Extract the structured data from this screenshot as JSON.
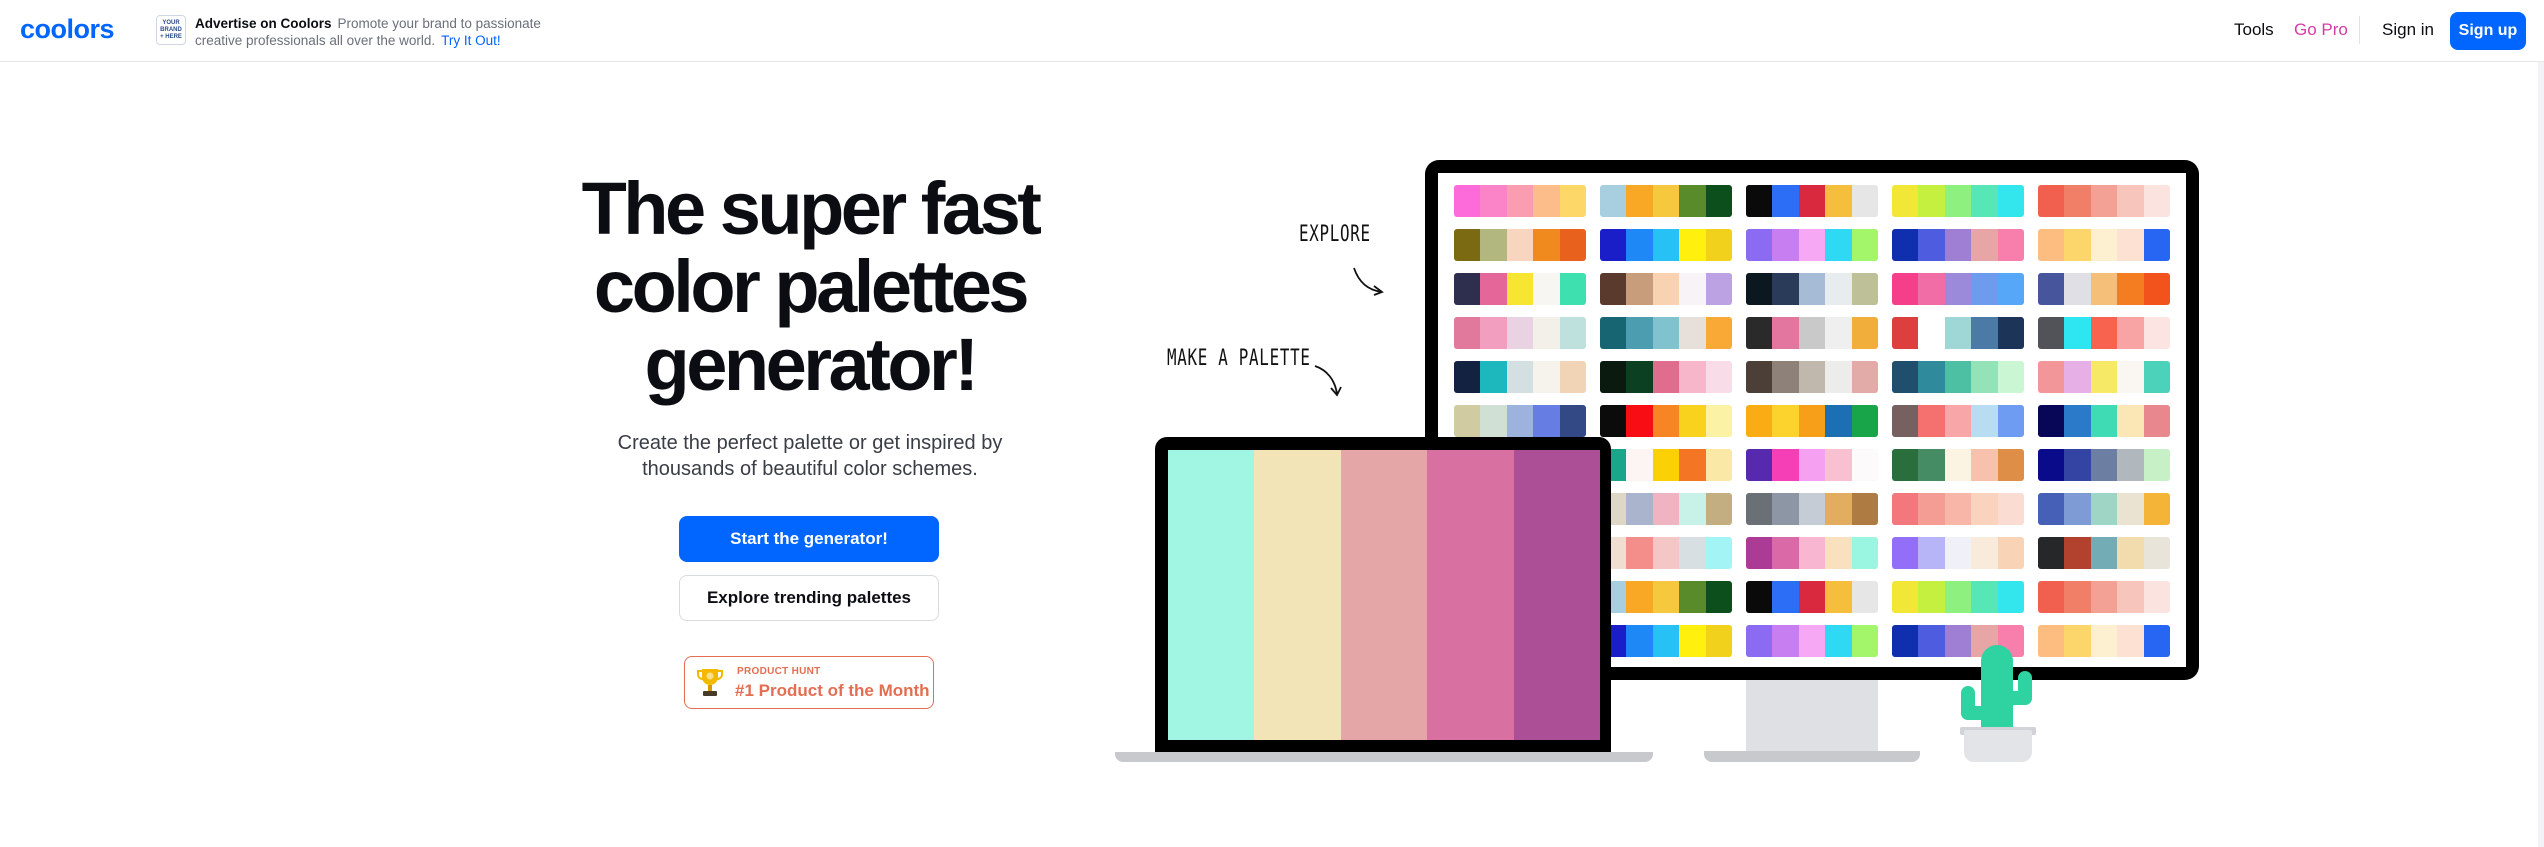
{
  "nav": {
    "logo": "coolors",
    "ad": {
      "badge_lines": [
        "YOUR",
        "BRAND",
        "+ HERE"
      ],
      "title": "Advertise on Coolors",
      "line1": "Promote your brand to passionate",
      "line2": "creative professionals all over the world.",
      "link": "Try It Out!"
    },
    "tools": "Tools",
    "go_pro": "Go Pro",
    "sign_in": "Sign in",
    "sign_up": "Sign up"
  },
  "hero": {
    "title_lines": [
      "The super fast",
      "color palettes",
      "generator!"
    ],
    "subtitle_lines": [
      "Create the perfect palette or get inspired by",
      "thousands of beautiful color schemes."
    ],
    "start_button": "Start the generator!",
    "explore_button": "Explore trending palettes",
    "product_hunt": {
      "small": "PRODUCT HUNT",
      "big": "#1 Product of the Month"
    }
  },
  "illustration": {
    "explore_label": "EXPLORE",
    "make_label": "MAKE A PALETTE",
    "laptop_palette": [
      "#a0f5e3",
      "#f3e4b8",
      "#e4a6a6",
      "#d970a2",
      "#ad4f97"
    ],
    "monitor_palettes": [
      [
        [
          "#fc6bd9",
          "#fb83c8",
          "#fb9db0",
          "#fcbd8b",
          "#fdd869"
        ],
        [
          "#a7cfe0",
          "#f9a826",
          "#f6c83d",
          "#5a8b2b",
          "#0c4e1c"
        ],
        [
          "#0a0a0a",
          "#2c6ff6",
          "#d8293e",
          "#f5be3c",
          "#e6e6e6"
        ],
        [
          "#f2e737",
          "#c5f03f",
          "#8ef07e",
          "#57e6b5",
          "#33e6ee"
        ],
        [
          "#f1604f",
          "#f17e66",
          "#f3a194",
          "#f8c5bd",
          "#fbe3df"
        ]
      ],
      [
        [
          "#7c6a13",
          "#b2b67f",
          "#f7d5bf",
          "#f18a1e",
          "#e9621d"
        ],
        [
          "#1a1ec8",
          "#1e88f6",
          "#27c1f5",
          "#fff00d",
          "#f2d11d"
        ],
        [
          "#8a6bf1",
          "#c77ef1",
          "#f6a8f4",
          "#2fd9f4",
          "#a3f56a"
        ],
        [
          "#102fae",
          "#4e5de0",
          "#9e7fd4",
          "#e7a5a5",
          "#f87fac"
        ],
        [
          "#fdbd81",
          "#fcd66a",
          "#fcf0d1",
          "#fde2d4",
          "#2766f2"
        ]
      ],
      [
        [
          "#2e2e4e",
          "#e5679a",
          "#f6e631",
          "#f7f6f2",
          "#3ee0b0"
        ],
        [
          "#5a3a2c",
          "#c89d7c",
          "#f9d2b2",
          "#f7f3f6",
          "#bca2e3"
        ],
        [
          "#0b1820",
          "#2a3b5a",
          "#a6bcd6",
          "#e7ecef",
          "#bec198"
        ],
        [
          "#f53f8a",
          "#f06da6",
          "#9a8ad9",
          "#6d9bee",
          "#56a7f8"
        ],
        [
          "#46559c",
          "#e0dfe6",
          "#f5bf7a",
          "#f47d22",
          "#f2521b"
        ]
      ],
      [
        [
          "#e0799c",
          "#f29fbf",
          "#e9d2e2",
          "#f3f0ea",
          "#bfe1de"
        ],
        [
          "#176573",
          "#4c9daf",
          "#80c3cf",
          "#e7e0da",
          "#f9a936"
        ],
        [
          "#2a2a2a",
          "#e3769f",
          "#c9c9c9",
          "#f0efef",
          "#f2ae3b"
        ],
        [
          "#dd3f3f",
          "#ffffff",
          "#9fd6d6",
          "#4a7aa5",
          "#1b3457"
        ],
        [
          "#515358",
          "#2ee6f1",
          "#f7634f",
          "#f8a4a4",
          "#fbe4e1"
        ]
      ],
      [
        [
          "#122240",
          "#1db7be",
          "#d4dfe2",
          "#f6f2ec",
          "#f1d4b6"
        ],
        [
          "#0a1a0e",
          "#0c4023",
          "#e06c8e",
          "#f8b6cb",
          "#f8dde8"
        ],
        [
          "#4b3f38",
          "#8e8179",
          "#c1b8ad",
          "#ececea",
          "#e2aba7"
        ],
        [
          "#1f4f6c",
          "#2f8a9c",
          "#4dc0a3",
          "#94e2b7",
          "#cbf6d4"
        ],
        [
          "#f2969a",
          "#e6b0e6",
          "#f5e966",
          "#faf6f1",
          "#4cd1ba"
        ]
      ],
      [
        [
          "#d1cba1",
          "#d1e0d5",
          "#9db3de",
          "#667ee3",
          "#324985"
        ],
        [
          "#0b0b0b",
          "#f70d13",
          "#f88524",
          "#f9d21e",
          "#fbf2a5"
        ],
        [
          "#f9ac13",
          "#fbd32c",
          "#f89f1a",
          "#1c6fb3",
          "#18a54a"
        ],
        [
          "#766160",
          "#f5716f",
          "#f9a6a8",
          "#b8dcf2",
          "#6e9cf3"
        ],
        [
          "#070657",
          "#2b79c9",
          "#3fdbb5",
          "#fbe6b5",
          "#e9878f"
        ]
      ],
      [
        [
          "#12a076",
          "#ffffff",
          "#f7e9d0",
          "#f16d2c",
          "#f9c9c4"
        ],
        [
          "#1aa68a",
          "#fdf5f4",
          "#fbd106",
          "#f47523",
          "#fae8a7"
        ],
        [
          "#5629ae",
          "#f53fb7",
          "#f5a0f0",
          "#f8c0d1",
          "#fcfafa"
        ],
        [
          "#2b6e3d",
          "#458c64",
          "#fbf4e2",
          "#f8c1ad",
          "#df8e47"
        ],
        [
          "#090b8a",
          "#3344a3",
          "#6c7fa3",
          "#b0b8bd",
          "#c8f0c6"
        ]
      ],
      [
        [
          "#efeeee",
          "#a89ac7",
          "#aec4dd",
          "#d2f6ec",
          "#d9cc9c"
        ],
        [
          "#ded7c5",
          "#aab5cd",
          "#f0b3c1",
          "#c8f1e7",
          "#c3ae81"
        ],
        [
          "#6b7077",
          "#8c96a5",
          "#c5ccd6",
          "#e2ad5e",
          "#ae7b43"
        ],
        [
          "#f3787d",
          "#f49d94",
          "#f8b6a9",
          "#fad3be",
          "#fbdcd2"
        ],
        [
          "#4660b7",
          "#7f9bd6",
          "#9fd5c4",
          "#eae3d2",
          "#f3b438"
        ]
      ],
      [
        [
          "#f37575",
          "#e99e9e",
          "#d6b6b6",
          "#b6d4d4",
          "#8ef4f4"
        ],
        [
          "#f0ded0",
          "#f38e8b",
          "#f5c6c6",
          "#d8dfe3",
          "#a2f5f4"
        ],
        [
          "#ab3b94",
          "#da6aa7",
          "#f8b6d0",
          "#f9e1bf",
          "#9af5e1"
        ],
        [
          "#936ef8",
          "#b7b4f8",
          "#f0f0f8",
          "#f9ebdb",
          "#f9d3b6"
        ],
        [
          "#252729",
          "#b2422e",
          "#73acb5",
          "#f2dcae",
          "#e9e4d9"
        ]
      ],
      [
        [
          "#a7cfe0",
          "#f9a826",
          "#f6c83d",
          "#5a8b2b",
          "#0c4e1c"
        ],
        [
          "#a7cfe0",
          "#f9a826",
          "#f6c83d",
          "#5a8b2b",
          "#0c4e1c"
        ],
        [
          "#0a0a0a",
          "#2c6ff6",
          "#d8293e",
          "#f5be3c",
          "#e6e6e6"
        ],
        [
          "#f2e737",
          "#c5f03f",
          "#8ef07e",
          "#57e6b5",
          "#33e6ee"
        ],
        [
          "#f1604f",
          "#f17e66",
          "#f3a194",
          "#f8c5bd",
          "#fbe3df"
        ]
      ],
      [
        [
          "#1a1ec8",
          "#1e88f6",
          "#27c1f5",
          "#fff00d",
          "#f2d11d"
        ],
        [
          "#1a1ec8",
          "#1e88f6",
          "#27c1f5",
          "#fff00d",
          "#f2d11d"
        ],
        [
          "#8a6bf1",
          "#c77ef1",
          "#f6a8f4",
          "#2fd9f4",
          "#a3f56a"
        ],
        [
          "#102fae",
          "#4e5de0",
          "#9e7fd4",
          "#e7a5a5",
          "#f87fac"
        ],
        [
          "#fdbd81",
          "#fcd66a",
          "#fcf0d1",
          "#fde2d4",
          "#2766f2"
        ]
      ]
    ]
  },
  "colors": {
    "brand_blue": "#0066ff",
    "go_pro_pink": "#d63ba6",
    "product_hunt_orange": "#e36e52",
    "cactus_green": "#2fd3a2"
  }
}
